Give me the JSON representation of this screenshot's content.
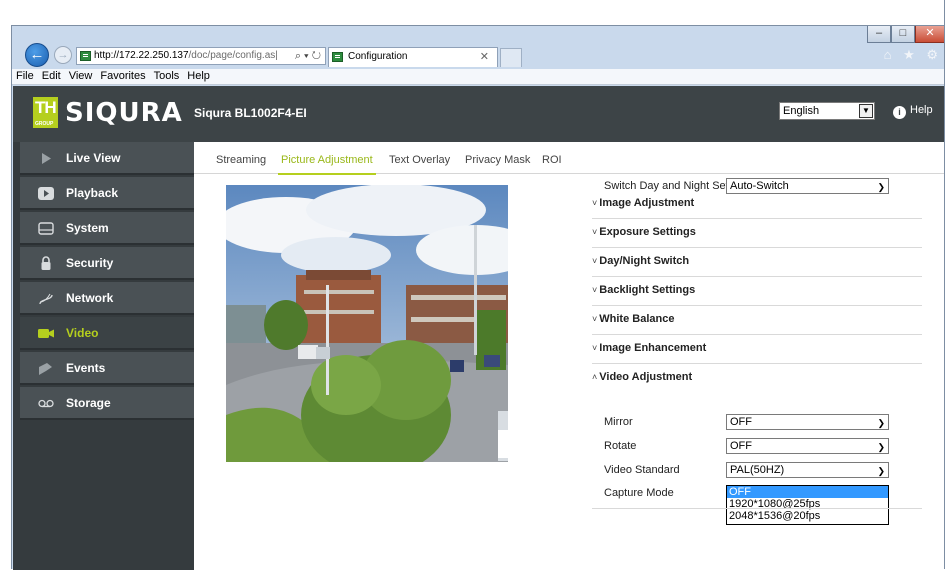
{
  "browser": {
    "url_host": "http://172.22.250.137",
    "url_path": "/doc/page/config.as|",
    "address_controls": "⌕ ▾ ↻",
    "tab_title": "Configuration",
    "tab_close": "✕",
    "toolbar_icons": "⌂ ★ ⚙",
    "window_controls": {
      "minimize": "–",
      "maximize": "□",
      "close": "✕"
    },
    "menu": [
      "File",
      "Edit",
      "View",
      "Favorites",
      "Tools",
      "Help"
    ]
  },
  "header": {
    "logo_text": "SIQURA",
    "logo_box_text": "TH",
    "logo_group_text": "GROUP",
    "device_name": "Siqura BL1002F4-EI",
    "language": "English",
    "help_label": "Help"
  },
  "sidebar": {
    "items": [
      {
        "label": "Live View",
        "icon": "play-arrow-icon"
      },
      {
        "label": "Playback",
        "icon": "playback-icon"
      },
      {
        "label": "System",
        "icon": "system-icon"
      },
      {
        "label": "Security",
        "icon": "lock-icon"
      },
      {
        "label": "Network",
        "icon": "network-icon"
      },
      {
        "label": "Video",
        "icon": "video-camera-icon",
        "active": true
      },
      {
        "label": "Events",
        "icon": "events-icon"
      },
      {
        "label": "Storage",
        "icon": "storage-icon"
      }
    ]
  },
  "tabs": [
    {
      "label": "Streaming"
    },
    {
      "label": "Picture Adjustment",
      "active": true
    },
    {
      "label": "Text Overlay"
    },
    {
      "label": "Privacy Mask"
    },
    {
      "label": "ROI"
    }
  ],
  "settings": {
    "switch_day_night_label": "Switch Day and Night Set...",
    "switch_day_night_value": "Auto-Switch",
    "sections": [
      {
        "label": "Image Adjustment",
        "expanded": false
      },
      {
        "label": "Exposure Settings",
        "expanded": false
      },
      {
        "label": "Day/Night Switch",
        "expanded": false
      },
      {
        "label": "Backlight Settings",
        "expanded": false
      },
      {
        "label": "White Balance",
        "expanded": false
      },
      {
        "label": "Image Enhancement",
        "expanded": false
      },
      {
        "label": "Video Adjustment",
        "expanded": true
      }
    ],
    "video_adjustment": {
      "mirror_label": "Mirror",
      "mirror_value": "OFF",
      "rotate_label": "Rotate",
      "rotate_value": "OFF",
      "video_standard_label": "Video Standard",
      "video_standard_value": "PAL(50HZ)",
      "capture_mode_label": "Capture Mode",
      "capture_mode_options": [
        "OFF",
        "1920*1080@25fps",
        "2048*1536@20fps"
      ],
      "capture_mode_selected": "OFF"
    }
  },
  "colors": {
    "accent": "#b5cf1e",
    "topbar": "#3d4447",
    "sidebar": "#4a5155",
    "selection": "#3399ff"
  }
}
